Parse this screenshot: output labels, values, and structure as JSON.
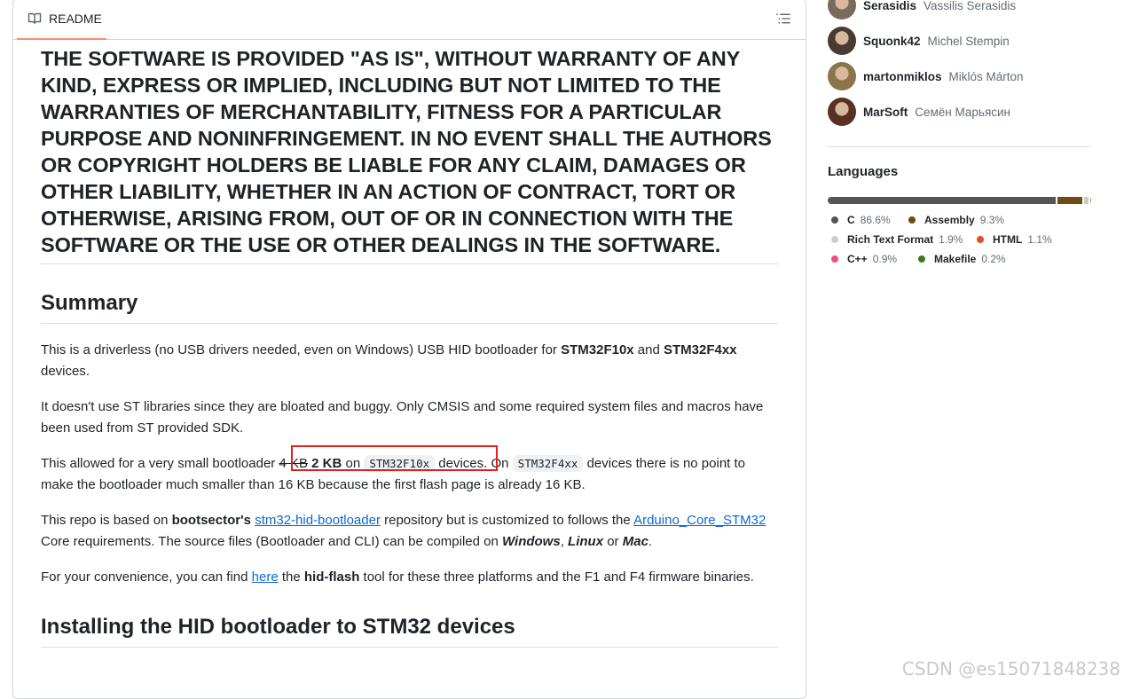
{
  "readme": {
    "tab_label": "README",
    "license_text": "THE SOFTWARE IS PROVIDED \"AS IS\", WITHOUT WARRANTY OF ANY KIND, EXPRESS OR IMPLIED, INCLUDING BUT NOT LIMITED TO THE WARRANTIES OF MERCHANTABILITY, FITNESS FOR A PARTICULAR PURPOSE AND NONINFRINGEMENT. IN NO EVENT SHALL THE AUTHORS OR COPYRIGHT HOLDERS BE LIABLE FOR ANY CLAIM, DAMAGES OR OTHER LIABILITY, WHETHER IN AN ACTION OF CONTRACT, TORT OR OTHERWISE, ARISING FROM, OUT OF OR IN CONNECTION WITH THE SOFTWARE OR THE USE OR OTHER DEALINGS IN THE SOFTWARE.",
    "summary_heading": "Summary",
    "p1": {
      "a": "This is a driverless (no USB drivers needed, even on Windows) USB HID bootloader for ",
      "b1": "STM32F10x",
      "c": " and ",
      "b2": "STM32F4xx",
      "d": " devices."
    },
    "p2": "It doesn't use ST libraries since they are bloated and buggy. Only CMSIS and some required system files and macros have been used from ST provided SDK.",
    "p3": {
      "a": "This allowed for a very small bootloader ",
      "strike": "4 KB",
      "bold": "2 KB",
      "b": " on ",
      "code1": "STM32F10x",
      "c": " devices. On ",
      "code2": "STM32F4xx",
      "d": " devices there is no point to make the bootloader much smaller than 16 KB because the first flash page is already 16 KB."
    },
    "p4": {
      "a": "This repo is based on ",
      "b1": "bootsector's",
      "sp": " ",
      "link1": "stm32-hid-bootloader",
      "c": " repository but is customized to follows the ",
      "link2": "Arduino_Core_STM32",
      "d": " Core requirements. The source files (Bootloader and CLI) can be compiled on ",
      "i1": "Windows",
      "e": ", ",
      "i2": "Linux",
      "f": " or ",
      "i3": "Mac",
      "g": "."
    },
    "p5": {
      "a": "For your convenience, you can find ",
      "link": "here",
      "b": " the ",
      "bold": "hid-flash",
      "c": " tool for these three platforms and the F1 and F4 firmware binaries."
    },
    "install_heading": "Installing the HID bootloader to STM32 devices"
  },
  "sidebar": {
    "contributors": [
      {
        "login": "Serasidis",
        "name": "Vassilis Serasidis",
        "avatar_color": "#7a6a5a"
      },
      {
        "login": "Squonk42",
        "name": "Michel Stempin",
        "avatar_color": "#4a3a30"
      },
      {
        "login": "martonmiklos",
        "name": "Miklós Márton",
        "avatar_color": "#8a7448"
      },
      {
        "login": "MarSoft",
        "name": "Семён Марьясин",
        "avatar_color": "#5a3020"
      }
    ],
    "languages_title": "Languages",
    "languages": [
      {
        "name": "C",
        "pct": "86.6%",
        "value": 86.6,
        "color": "#555555"
      },
      {
        "name": "Assembly",
        "pct": "9.3%",
        "value": 9.3,
        "color": "#6E4C13"
      },
      {
        "name": "Rich Text Format",
        "pct": "1.9%",
        "value": 1.9,
        "color": "#cccccc"
      },
      {
        "name": "HTML",
        "pct": "1.1%",
        "value": 1.1,
        "color": "#e34c26"
      },
      {
        "name": "C++",
        "pct": "0.9%",
        "value": 0.9,
        "color": "#f34b7d"
      },
      {
        "name": "Makefile",
        "pct": "0.2%",
        "value": 0.2,
        "color": "#427819"
      }
    ]
  },
  "watermark": "CSDN @es15071848238"
}
